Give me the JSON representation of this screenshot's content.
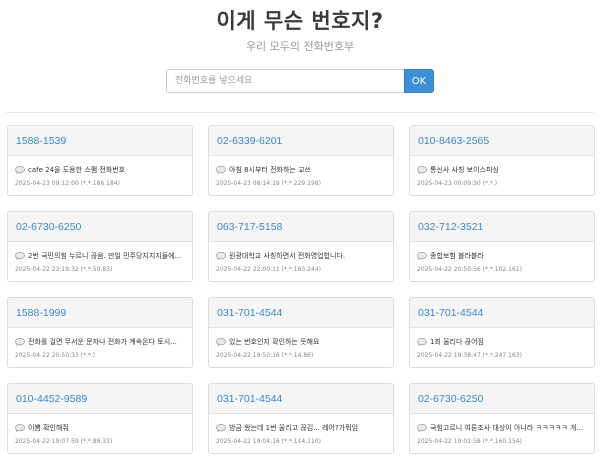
{
  "header": {
    "title": "이게 무슨 번호지?",
    "subtitle": "우리 모두의 전화번호부"
  },
  "search": {
    "placeholder": "전화번호를 넣으세요",
    "value": "",
    "button_label": "OK"
  },
  "colors": {
    "accent": "#3d8fd4",
    "link": "#3b87c8"
  },
  "cards": [
    {
      "number": "1588-1539",
      "comment": "cafe 24을 도용한 스팸 전화번호",
      "meta": "2025-04-23 09:12:00 (*.*.186.184)"
    },
    {
      "number": "02-6339-6201",
      "comment": "아침 8시부터 전화하는 교쓰",
      "meta": "2025-04-23 08:14:19 (*.*.229.198)"
    },
    {
      "number": "010-8463-2565",
      "comment": "통신사 사칭 보이스피싱",
      "meta": "2025-04-23 00:09:30 (*.*.)"
    },
    {
      "number": "02-6730-6250",
      "comment": "2번 국민의힘 누르니 끊음. 만일 민주당지지지들에...",
      "meta": "2025-04-22 23:19:32 (*.*.50.83)"
    },
    {
      "number": "063-717-5158",
      "comment": "원광대학교 사칭하면서 전화영업합니다.",
      "meta": "2025-04-22 22:00:11 (*.*.163.244)"
    },
    {
      "number": "032-712-3521",
      "comment": "종합보험 블라블라",
      "meta": "2025-04-22 20:50:56 (*.*.102.161)"
    },
    {
      "number": "1588-1999",
      "comment": "전화를 걸면 무서운 문자나 전화가 계속온다 토시...",
      "meta": "2025-04-22 20:50:33 (*.*.)"
    },
    {
      "number": "031-701-4544",
      "comment": "있는 번호인지 확인하는 듯해요",
      "meta": "2025-04-22 19:50:16 (*.*.14.86)"
    },
    {
      "number": "031-701-4544",
      "comment": "1회 울리다 끊어짐",
      "meta": "2025-04-22 19:38:47 (*.*.247.163)"
    },
    {
      "number": "010-4452-9589",
      "comment": "이쁨 확인해줘",
      "meta": "2025-04-22 19:07:59 (*.*.88.33)"
    },
    {
      "number": "031-701-4544",
      "comment": "방금 왔는데 1번 울리고 끊김... 레어?가뭐임",
      "meta": "2025-04-22 19:04:16 (*.*.114.110)"
    },
    {
      "number": "02-6730-6250",
      "comment": "국힘고르니 여론조사 대상이 아니라 ㅋㅋㅋㅋㅋ 개...",
      "meta": "2025-04-22 19:02:58 (*.*.160.154)"
    }
  ]
}
